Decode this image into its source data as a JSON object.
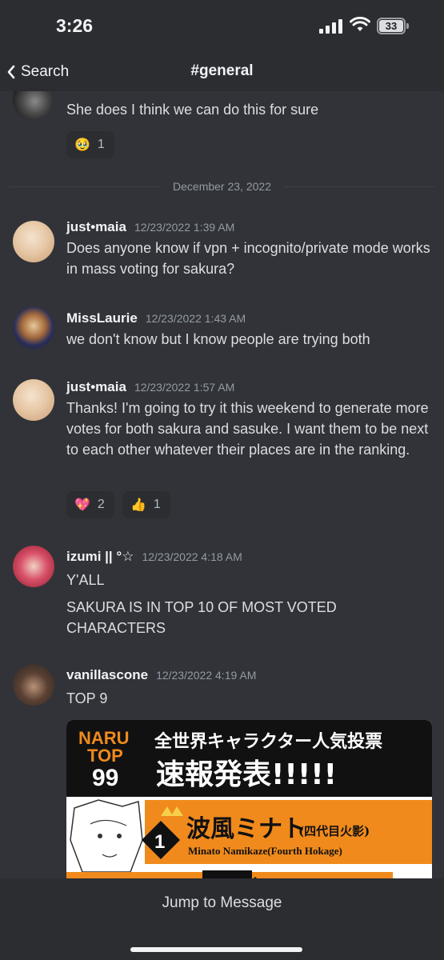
{
  "status_bar": {
    "time": "3:26",
    "battery": "33"
  },
  "nav": {
    "back_label": "Search",
    "channel": "#general"
  },
  "messages": [
    {
      "text": "She does I think we can do this for sure",
      "reactions": [
        {
          "emoji": "🥹",
          "count": "1"
        }
      ]
    },
    {
      "date_divider": "December 23, 2022"
    },
    {
      "username": "just•maia",
      "timestamp": "12/23/2022 1:39 AM",
      "text": "Does anyone know if vpn + incognito/private mode works in mass voting for sakura?"
    },
    {
      "username": "MissLaurie",
      "timestamp": "12/23/2022 1:43 AM",
      "text": "we don't know but I know people are trying both"
    },
    {
      "username": "just•maia",
      "timestamp": "12/23/2022 1:57 AM",
      "text": "Thanks! I'm going to try it this weekend to generate more votes for both sakura and sasuke. I want them to be next to each other whatever their places are in the ranking.",
      "reactions": [
        {
          "emoji": "💖",
          "count": "2"
        },
        {
          "emoji": "👍",
          "count": "1"
        }
      ]
    },
    {
      "username": "izumi || °☆",
      "timestamp": "12/23/2022 4:18 AM",
      "lines": [
        "Y'ALL",
        "SAKURA IS IN TOP 10 OF MOST VOTED CHARACTERS"
      ]
    },
    {
      "username": "vanillascone",
      "timestamp": "12/23/2022 4:19 AM",
      "text": "TOP 9"
    }
  ],
  "embed": {
    "logo_line1": "NARU",
    "logo_line2": "TOP",
    "logo_line3": "99",
    "headline_top": "全世界キャラクター人気投票",
    "headline_main": "速報発表!!!!!",
    "rank": "1",
    "name_jp": "波風ミナト",
    "name_jp_suffix": "(四代目火影)",
    "name_en": "Minato Namikaze(Fourth Hokage)",
    "colors": {
      "orange": "#f08a1c",
      "black": "#111111"
    }
  },
  "bottom": {
    "jump_label": "Jump to Message"
  },
  "colors": {
    "background": "#313338",
    "bar": "#2b2d31",
    "text": "#dbdee1",
    "muted": "#949ba4"
  }
}
